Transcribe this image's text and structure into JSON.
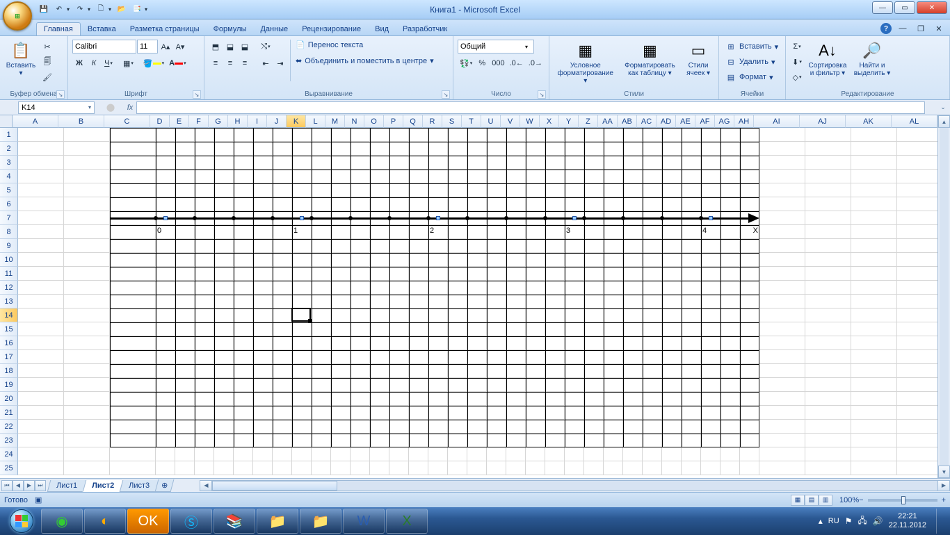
{
  "window": {
    "title": "Книга1 - Microsoft Excel"
  },
  "tabs": {
    "home": "Главная",
    "insert": "Вставка",
    "layout": "Разметка страницы",
    "formulas": "Формулы",
    "data": "Данные",
    "review": "Рецензирование",
    "view": "Вид",
    "developer": "Разработчик"
  },
  "ribbon": {
    "clipboard": {
      "title": "Буфер обмена",
      "paste": "Вставить"
    },
    "font": {
      "title": "Шрифт",
      "name": "Calibri",
      "size": "11",
      "bold": "Ж",
      "italic": "К",
      "underline": "Ч"
    },
    "align": {
      "title": "Выравнивание",
      "wrap": "Перенос текста",
      "merge": "Объединить и поместить в центре"
    },
    "number": {
      "title": "Число",
      "format": "Общий"
    },
    "styles": {
      "title": "Стили",
      "cond": "Условное форматирование",
      "table": "Форматировать как таблицу",
      "cell": "Стили ячеек"
    },
    "cells": {
      "title": "Ячейки",
      "insert": "Вставить",
      "delete": "Удалить",
      "format": "Формат"
    },
    "editing": {
      "title": "Редактирование",
      "sort": "Сортировка и фильтр",
      "find": "Найти и выделить"
    }
  },
  "namebox": "K14",
  "columns": [
    "A",
    "B",
    "C",
    "D",
    "E",
    "F",
    "G",
    "H",
    "I",
    "J",
    "K",
    "L",
    "M",
    "N",
    "O",
    "P",
    "Q",
    "R",
    "S",
    "T",
    "U",
    "V",
    "W",
    "X",
    "Y",
    "Z",
    "AA",
    "AB",
    "AC",
    "AD",
    "AE",
    "AF",
    "AG",
    "AH",
    "AI",
    "AJ",
    "AK",
    "AL"
  ],
  "col_widths": {
    "default_wide": 66,
    "default_narrow": 28,
    "narrow_from": 3,
    "narrow_to": 33
  },
  "row_count": 25,
  "selected_cell": {
    "col": 10,
    "row": 14
  },
  "axis": {
    "labels": [
      {
        "col": 3,
        "text": "0"
      },
      {
        "col": 10,
        "text": "1"
      },
      {
        "col": 17,
        "text": "2"
      },
      {
        "col": 24,
        "text": "3"
      },
      {
        "col": 31,
        "text": "4"
      },
      {
        "col": 33,
        "text": "X",
        "align": "right"
      }
    ],
    "handles_cols": [
      3,
      10,
      17,
      24,
      31
    ]
  },
  "sheets": {
    "s1": "Лист1",
    "s2": "Лист2",
    "s3": "Лист3"
  },
  "status": {
    "ready": "Готово",
    "zoom": "100%"
  },
  "tray": {
    "lang": "RU",
    "time": "22:21",
    "date": "22.11.2012"
  }
}
